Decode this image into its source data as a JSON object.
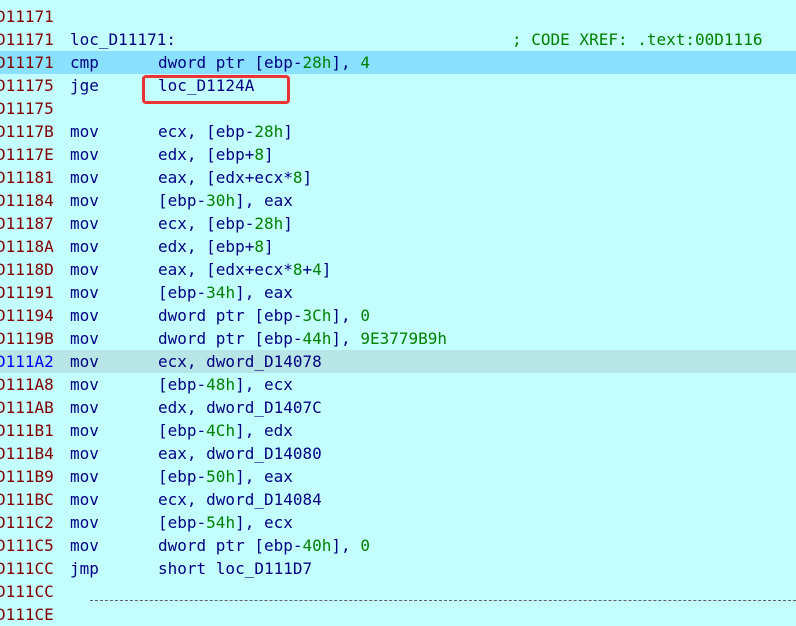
{
  "lines": [
    {
      "addr": "D11171",
      "mnem": "",
      "ops": []
    },
    {
      "addr": "D11171",
      "label": "loc_D11171:",
      "comment": "; CODE XREF: .text:00D1116"
    },
    {
      "addr": "D11171",
      "mnem": "cmp",
      "ops": [
        [
          "dword ptr [ebp-",
          "t"
        ],
        [
          "28h",
          "n"
        ],
        [
          "], ",
          "t"
        ],
        [
          "4",
          "n"
        ]
      ],
      "selected": true
    },
    {
      "addr": "D11175",
      "mnem": "jge",
      "ops": [
        [
          "loc_D1124A",
          "t"
        ]
      ]
    },
    {
      "addr": "D11175",
      "mnem": "",
      "ops": []
    },
    {
      "addr": "D1117B",
      "mnem": "mov",
      "ops": [
        [
          "ecx, [ebp-",
          "t"
        ],
        [
          "28h",
          "n"
        ],
        [
          "]",
          "t"
        ]
      ]
    },
    {
      "addr": "D1117E",
      "mnem": "mov",
      "ops": [
        [
          "edx, [ebp+",
          "t"
        ],
        [
          "8",
          "n"
        ],
        [
          "]",
          "t"
        ]
      ]
    },
    {
      "addr": "D11181",
      "mnem": "mov",
      "ops": [
        [
          "eax, [edx+ecx*",
          "t"
        ],
        [
          "8",
          "n"
        ],
        [
          "]",
          "t"
        ]
      ]
    },
    {
      "addr": "D11184",
      "mnem": "mov",
      "ops": [
        [
          "[ebp-",
          "t"
        ],
        [
          "30h",
          "n"
        ],
        [
          "], eax",
          "t"
        ]
      ]
    },
    {
      "addr": "D11187",
      "mnem": "mov",
      "ops": [
        [
          "ecx, [ebp-",
          "t"
        ],
        [
          "28h",
          "n"
        ],
        [
          "]",
          "t"
        ]
      ]
    },
    {
      "addr": "D1118A",
      "mnem": "mov",
      "ops": [
        [
          "edx, [ebp+",
          "t"
        ],
        [
          "8",
          "n"
        ],
        [
          "]",
          "t"
        ]
      ]
    },
    {
      "addr": "D1118D",
      "mnem": "mov",
      "ops": [
        [
          "eax, [edx+ecx*",
          "t"
        ],
        [
          "8",
          "n"
        ],
        [
          "+",
          "t"
        ],
        [
          "4",
          "n"
        ],
        [
          "]",
          "t"
        ]
      ]
    },
    {
      "addr": "D11191",
      "mnem": "mov",
      "ops": [
        [
          "[ebp-",
          "t"
        ],
        [
          "34h",
          "n"
        ],
        [
          "], eax",
          "t"
        ]
      ]
    },
    {
      "addr": "D11194",
      "mnem": "mov",
      "ops": [
        [
          "dword ptr [ebp-",
          "t"
        ],
        [
          "3Ch",
          "n"
        ],
        [
          "], ",
          "t"
        ],
        [
          "0",
          "n"
        ]
      ]
    },
    {
      "addr": "D1119B",
      "mnem": "mov",
      "ops": [
        [
          "dword ptr [ebp-",
          "t"
        ],
        [
          "44h",
          "n"
        ],
        [
          "], ",
          "t"
        ],
        [
          "9E3779B9h",
          "n"
        ]
      ]
    },
    {
      "addr": "D111A2",
      "mnem": "mov",
      "ops": [
        [
          "ecx, dword_D14078",
          "t"
        ]
      ],
      "highlight": true
    },
    {
      "addr": "D111A8",
      "mnem": "mov",
      "ops": [
        [
          "[ebp-",
          "t"
        ],
        [
          "48h",
          "n"
        ],
        [
          "], ecx",
          "t"
        ]
      ]
    },
    {
      "addr": "D111AB",
      "mnem": "mov",
      "ops": [
        [
          "edx, dword_D1407C",
          "t"
        ]
      ]
    },
    {
      "addr": "D111B1",
      "mnem": "mov",
      "ops": [
        [
          "[ebp-",
          "t"
        ],
        [
          "4Ch",
          "n"
        ],
        [
          "], edx",
          "t"
        ]
      ]
    },
    {
      "addr": "D111B4",
      "mnem": "mov",
      "ops": [
        [
          "eax, dword_D14080",
          "t"
        ]
      ]
    },
    {
      "addr": "D111B9",
      "mnem": "mov",
      "ops": [
        [
          "[ebp-",
          "t"
        ],
        [
          "50h",
          "n"
        ],
        [
          "], eax",
          "t"
        ]
      ]
    },
    {
      "addr": "D111BC",
      "mnem": "mov",
      "ops": [
        [
          "ecx, dword_D14084",
          "t"
        ]
      ]
    },
    {
      "addr": "D111C2",
      "mnem": "mov",
      "ops": [
        [
          "[ebp-",
          "t"
        ],
        [
          "54h",
          "n"
        ],
        [
          "], ecx",
          "t"
        ]
      ]
    },
    {
      "addr": "D111C5",
      "mnem": "mov",
      "ops": [
        [
          "dword ptr [ebp-",
          "t"
        ],
        [
          "40h",
          "n"
        ],
        [
          "], ",
          "t"
        ],
        [
          "0",
          "n"
        ]
      ]
    },
    {
      "addr": "D111CC",
      "mnem": "jmp",
      "ops": [
        [
          "short loc_D111D7",
          "t"
        ]
      ]
    },
    {
      "addr": "D111CC",
      "mnem": "",
      "ops": []
    },
    {
      "addr": "D111CE",
      "mnem": "",
      "ops": []
    }
  ],
  "colors": {
    "background": "#c4ffff",
    "selected_row": "#8ae0ff",
    "highlight_row": "#b8e6e6",
    "address": "#800000",
    "operand": "#000080",
    "number": "#008000",
    "comment": "#008000",
    "callout_border": "#ee3333"
  }
}
